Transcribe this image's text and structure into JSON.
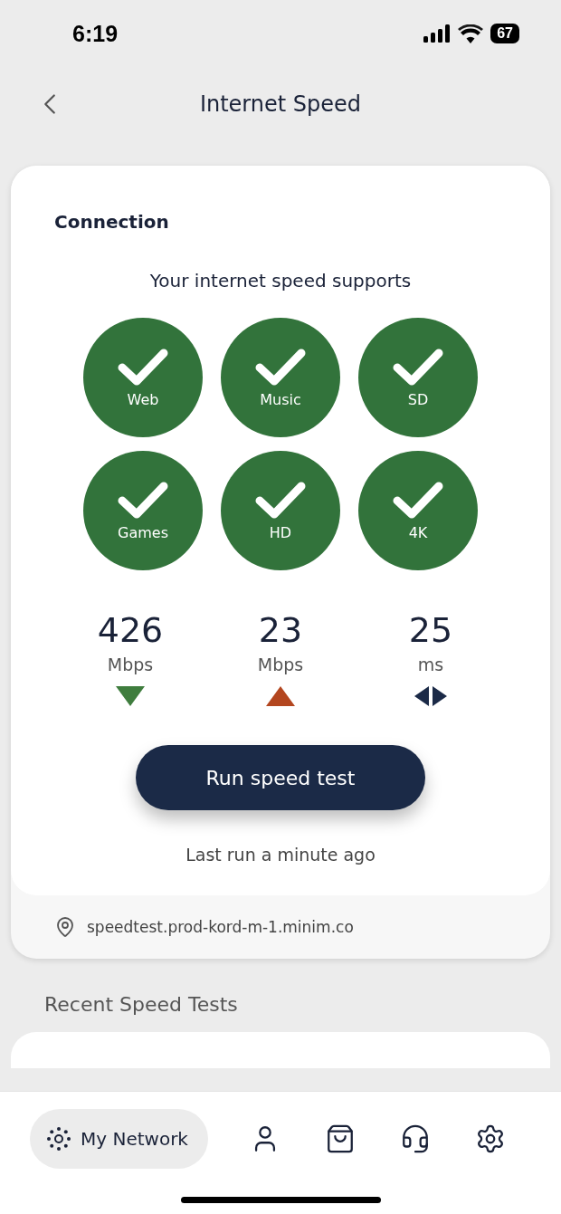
{
  "status_bar": {
    "time": "6:19",
    "battery": "67"
  },
  "header": {
    "title": "Internet Speed"
  },
  "connection": {
    "title": "Connection",
    "subtitle": "Your internet speed supports",
    "supports": [
      {
        "label": "Web",
        "supported": true
      },
      {
        "label": "Music",
        "supported": true
      },
      {
        "label": "SD",
        "supported": true
      },
      {
        "label": "Games",
        "supported": true
      },
      {
        "label": "HD",
        "supported": true
      },
      {
        "label": "4K",
        "supported": true
      }
    ],
    "metrics": [
      {
        "kind": "download",
        "value": "426",
        "unit": "Mbps"
      },
      {
        "kind": "upload",
        "value": "23",
        "unit": "Mbps"
      },
      {
        "kind": "latency",
        "value": "25",
        "unit": "ms"
      }
    ],
    "run_button": "Run speed test",
    "last_run": "Last run a minute ago",
    "server": "speedtest.prod-kord-m-1.minim.co"
  },
  "recent": {
    "title": "Recent Speed Tests"
  },
  "nav": [
    {
      "kind": "network",
      "label": "My Network",
      "selected": true
    },
    {
      "kind": "person",
      "selected": false
    },
    {
      "kind": "bag",
      "selected": false
    },
    {
      "kind": "headset",
      "selected": false
    },
    {
      "kind": "gear",
      "selected": false
    }
  ]
}
